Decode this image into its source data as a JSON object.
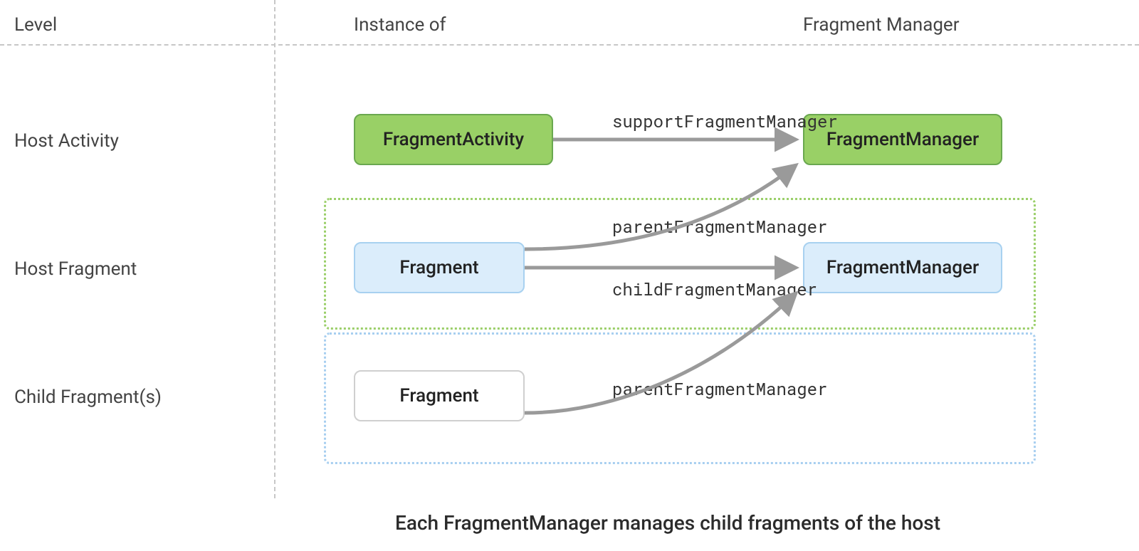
{
  "headers": {
    "level": "Level",
    "instance_of": "Instance of",
    "fragment_manager": "Fragment Manager"
  },
  "rows": {
    "host_activity": "Host Activity",
    "host_fragment": "Host Fragment",
    "child_fragments": "Child Fragment(s)"
  },
  "boxes": {
    "fragment_activity": "FragmentActivity",
    "fragment_manager_green": "FragmentManager",
    "fragment_blue": "Fragment",
    "fragment_manager_blue": "FragmentManager",
    "fragment_white": "Fragment"
  },
  "arrows": {
    "support": "supportFragmentManager",
    "parent_top": "parentFragmentManager",
    "child": "childFragmentManager",
    "parent_bottom": "parentFragmentManager"
  },
  "caption": "Each FragmentManager manages child fragments of the host",
  "colors": {
    "green_fill": "#99d066",
    "green_stroke": "#6aa84f",
    "blue_fill": "#dbedfb",
    "blue_stroke": "#a8d1f0",
    "arrow": "#9a9a9a"
  }
}
